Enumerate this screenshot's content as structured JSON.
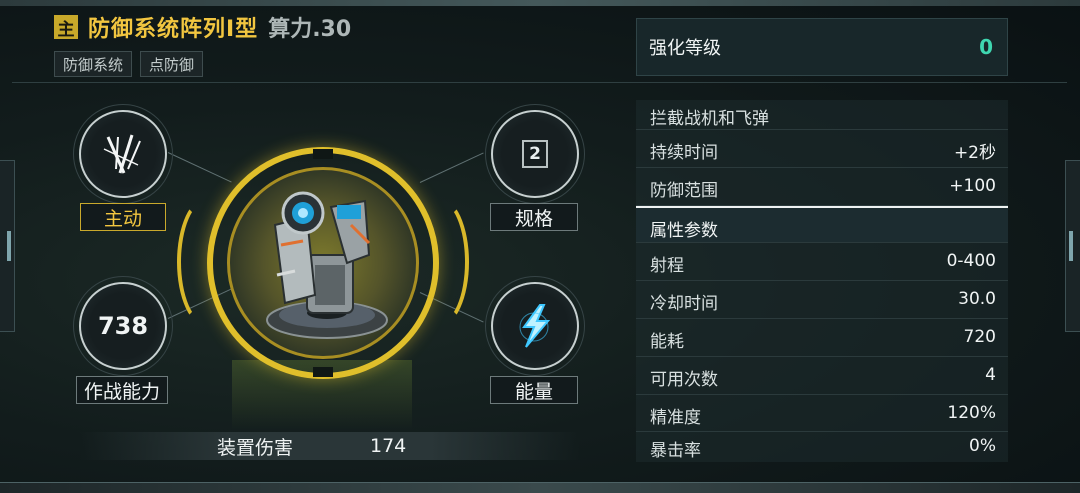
{
  "header": {
    "badge": "主",
    "title": "防御系统阵列Ⅰ型",
    "power": "算力.30",
    "tags": [
      "防御系统",
      "点防御"
    ]
  },
  "stats_nodes": {
    "mode": {
      "label": "主动",
      "icon": "slash-marks-icon"
    },
    "spec": {
      "value": "2",
      "label": "规格"
    },
    "combat": {
      "value": "738",
      "label": "作战能力"
    },
    "energy": {
      "label": "能量",
      "icon": "energy-bolt-icon"
    }
  },
  "damage": {
    "label": "装置伤害",
    "value": "174"
  },
  "enhance": {
    "label": "强化等级",
    "value": "0"
  },
  "attributes": {
    "description": "拦截战机和飞弹",
    "effect_rows": [
      {
        "k": "持续时间",
        "v": "+2秒"
      },
      {
        "k": "防御范围",
        "v": "+100"
      }
    ],
    "section_title": "属性参数",
    "param_rows": [
      {
        "k": "射程",
        "v": "0-400"
      },
      {
        "k": "冷却时间",
        "v": "30.0"
      },
      {
        "k": "能耗",
        "v": "720"
      },
      {
        "k": "可用次数",
        "v": "4"
      },
      {
        "k": "精准度",
        "v": "120%"
      },
      {
        "k": "暴击率",
        "v": "0%"
      }
    ]
  },
  "colors": {
    "accent_gold": "#e0bf2b",
    "accent_teal": "#3fd6b0",
    "title_gold": "#f2c640"
  }
}
